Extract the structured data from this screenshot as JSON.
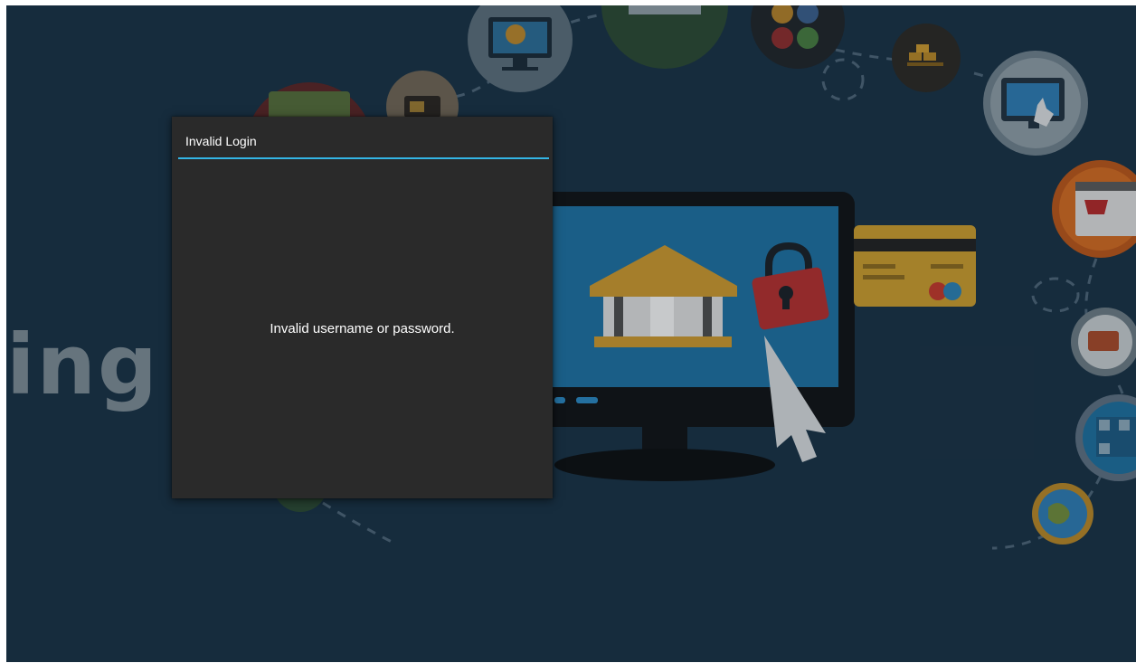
{
  "background": {
    "partial_word": "ing",
    "icons": [
      "monitor-cursor-icon",
      "wallet-icon",
      "money-icon",
      "currency-coins-icon",
      "gold-bars-icon",
      "shopping-cart-monitor-icon",
      "web-shop-cart-icon",
      "shop-basket-icon",
      "qr-code-icon",
      "globe-icon",
      "banking-monitor-icon",
      "padlock-icon",
      "credit-card-icon",
      "mouse-cursor-icon",
      "cash-notes-icon"
    ]
  },
  "dialog": {
    "title": "Invalid Login",
    "message": "Invalid username or password.",
    "accent_color": "#33b5e5",
    "background_color": "#2a2a2a"
  }
}
